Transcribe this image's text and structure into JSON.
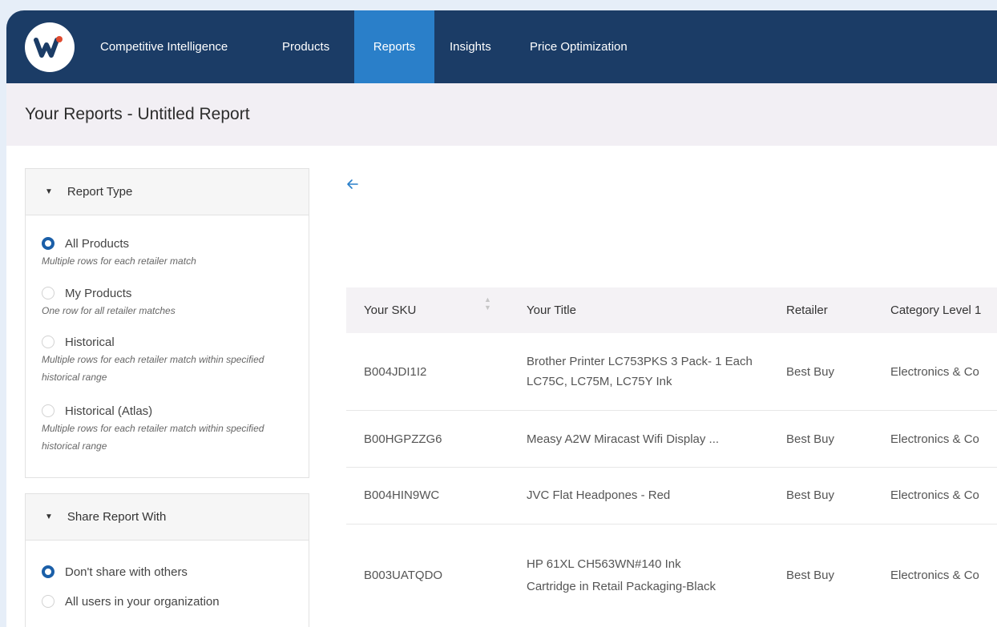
{
  "nav": {
    "logo_letter": "W",
    "items": [
      {
        "label": "Competitive Intelligence"
      },
      {
        "label": "Products"
      },
      {
        "label": "Reports"
      },
      {
        "label": "Insights"
      },
      {
        "label": "Price Optimization"
      }
    ],
    "active": "Reports"
  },
  "page": {
    "title": "Your Reports - Untitled Report"
  },
  "report_type": {
    "header": "Report Type",
    "options": [
      {
        "label": "All Products",
        "desc": "Multiple rows for each retailer match",
        "selected": true
      },
      {
        "label": "My Products",
        "desc": "One row for all retailer matches",
        "selected": false
      },
      {
        "label": "Historical",
        "desc": "Multiple rows for each retailer match within specified historical range",
        "selected": false
      },
      {
        "label": "Historical (Atlas)",
        "desc": "Multiple rows for each retailer match within specified historical range",
        "selected": false
      }
    ]
  },
  "share": {
    "header": "Share Report With",
    "options": [
      {
        "label": "Don't share with others",
        "selected": true
      },
      {
        "label": "All users in your organization",
        "selected": false
      }
    ]
  },
  "table": {
    "columns": [
      "Your SKU",
      "Your Title",
      "Retailer",
      "Category Level 1"
    ],
    "rows": [
      {
        "sku": "B004JDI1I2",
        "title": "Brother Printer LC753PKS 3 Pack- 1 Each LC75C, LC75M, LC75Y Ink",
        "retailer": "Best Buy",
        "category": "Electronics & Co"
      },
      {
        "sku": "B00HGPZZG6",
        "title": "Measy A2W Miracast Wifi Display ...",
        "retailer": "Best Buy",
        "category": "Electronics & Co"
      },
      {
        "sku": "B004HIN9WC",
        "title": "JVC Flat Headpones - Red",
        "retailer": "Best Buy",
        "category": "Electronics & Co"
      },
      {
        "sku": "B003UATQDO",
        "title": "HP 61XL CH563WN#140 Ink Cartridge in Retail Packaging-Black",
        "retailer": "Best Buy",
        "category": "Electronics & Co"
      }
    ]
  },
  "colors": {
    "nav_bg": "#1b3c66",
    "active_tab": "#2a7fc9",
    "radio_on": "#1b5fa8"
  },
  "icons": {
    "back": "arrow-left-icon",
    "caret": "caret-down-icon",
    "sort": "sort-icon"
  }
}
